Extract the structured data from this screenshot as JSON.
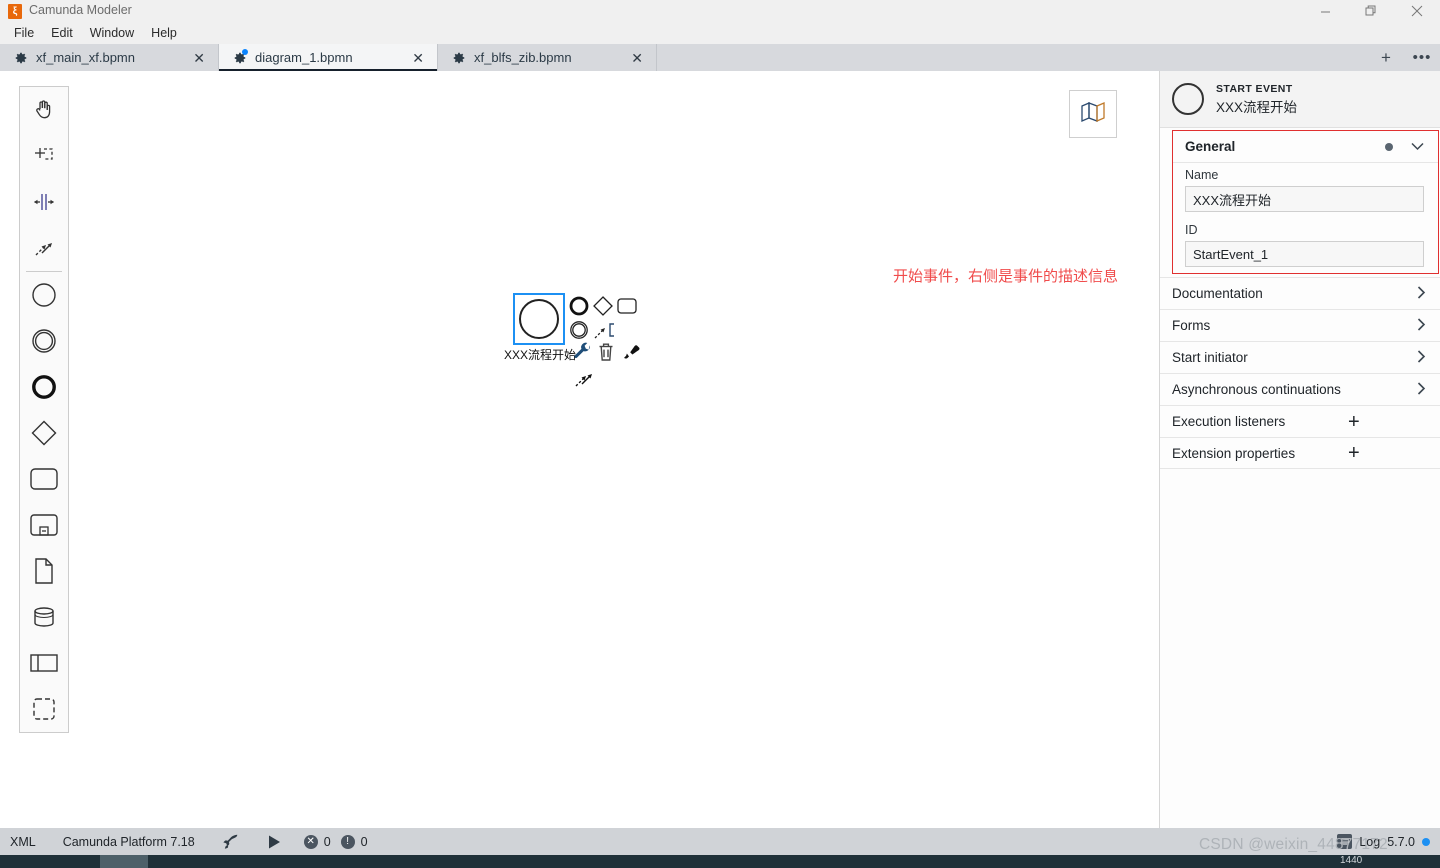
{
  "window": {
    "app_icon": "camunda-icon",
    "title": "Camunda Modeler",
    "minimize": "–",
    "maximize": "❐",
    "close": "✕"
  },
  "menubar": {
    "items": [
      {
        "label": "File"
      },
      {
        "label": "Edit"
      },
      {
        "label": "Window"
      },
      {
        "label": "Help"
      }
    ]
  },
  "tabbar": {
    "tabs": [
      {
        "label": "xf_main_xf.bpmn",
        "active": false,
        "modified": false,
        "close": "✕",
        "icon": "gear-icon"
      },
      {
        "label": "diagram_1.bpmn",
        "active": true,
        "modified": true,
        "close": "✕",
        "icon": "gear-icon"
      },
      {
        "label": "xf_blfs_zib.bpmn",
        "active": false,
        "modified": false,
        "close": "✕",
        "icon": "gear-icon"
      }
    ],
    "new_tab": "+",
    "overflow": "•••"
  },
  "canvas": {
    "palette": {
      "tools": [
        {
          "name": "hand-tool",
          "title": "Activate the hand tool"
        },
        {
          "name": "lasso-tool",
          "title": "Activate the lasso tool"
        },
        {
          "name": "space-tool",
          "title": "Activate the create/remove space tool"
        },
        {
          "name": "connect-tool",
          "title": "Activate the global connect tool"
        }
      ],
      "elements": [
        {
          "name": "start-event-tool",
          "title": "Create StartEvent"
        },
        {
          "name": "intermediate-event-tool",
          "title": "Create Intermediate/Boundary Event"
        },
        {
          "name": "end-event-tool",
          "title": "Create EndEvent"
        },
        {
          "name": "gateway-tool",
          "title": "Create Gateway"
        },
        {
          "name": "task-tool",
          "title": "Create Task"
        },
        {
          "name": "subprocess-expanded-tool",
          "title": "Create expanded SubProcess"
        },
        {
          "name": "data-object-tool",
          "title": "Create DataObjectReference"
        },
        {
          "name": "data-store-tool",
          "title": "Create DataStoreReference"
        },
        {
          "name": "participant-tool",
          "title": "Create Pool/Participant"
        },
        {
          "name": "group-tool",
          "title": "Create Group"
        }
      ]
    },
    "minimap_toggle": "map-icon",
    "shape": {
      "type": "start-event",
      "label": "XXX流程开始",
      "selected": true
    },
    "context_pad": [
      {
        "name": "append-intermediate-event-icon"
      },
      {
        "name": "append-gateway-icon"
      },
      {
        "name": "append-task-icon"
      },
      {
        "name": "append-end-event-icon"
      },
      {
        "name": "append-text-annotation-icon"
      },
      {
        "name": "wrench-icon"
      },
      {
        "name": "delete-icon"
      },
      {
        "name": "paintbrush-icon"
      },
      {
        "name": "connect-icon"
      }
    ],
    "annotation": "开始事件，右侧是事件的描述信息"
  },
  "properties": {
    "header": {
      "type": "START EVENT",
      "name": "XXX流程开始",
      "icon": "start-event-icon"
    },
    "general": {
      "title": "General",
      "dot": "●",
      "chevron": "⌄",
      "name_label": "Name",
      "name_value": "XXX流程开始",
      "name_placeholder": "",
      "id_label": "ID",
      "id_value": "StartEvent_1",
      "id_placeholder": ""
    },
    "groups": [
      {
        "label": "Documentation",
        "affordance": "chevron",
        "symbol": "›"
      },
      {
        "label": "Forms",
        "affordance": "chevron",
        "symbol": "›"
      },
      {
        "label": "Start initiator",
        "affordance": "chevron",
        "symbol": "›"
      },
      {
        "label": "Asynchronous continuations",
        "affordance": "chevron",
        "symbol": "›"
      },
      {
        "label": "Execution listeners",
        "affordance": "plus",
        "symbol": "+"
      },
      {
        "label": "Extension properties",
        "affordance": "plus",
        "symbol": "+"
      }
    ]
  },
  "statusbar": {
    "xml": "XML",
    "platform": "Camunda Platform 7.18",
    "deploy_icon": "rocket-icon",
    "run_icon": "play-icon",
    "errors": "0",
    "warnings": "0",
    "log_label": "Log",
    "version": "5.7.0"
  },
  "watermark": "CSDN @weixin_44877172",
  "taskbar": {
    "clock": "1440"
  },
  "colors": {
    "accent_blue": "#1c90f3",
    "annotation_red": "#f04c4c",
    "panel_red_border": "#e03030",
    "brand_orange": "#e8680b",
    "tabbar_bg": "#d7d9dd",
    "statusbar_bg": "#d0d3d7"
  }
}
